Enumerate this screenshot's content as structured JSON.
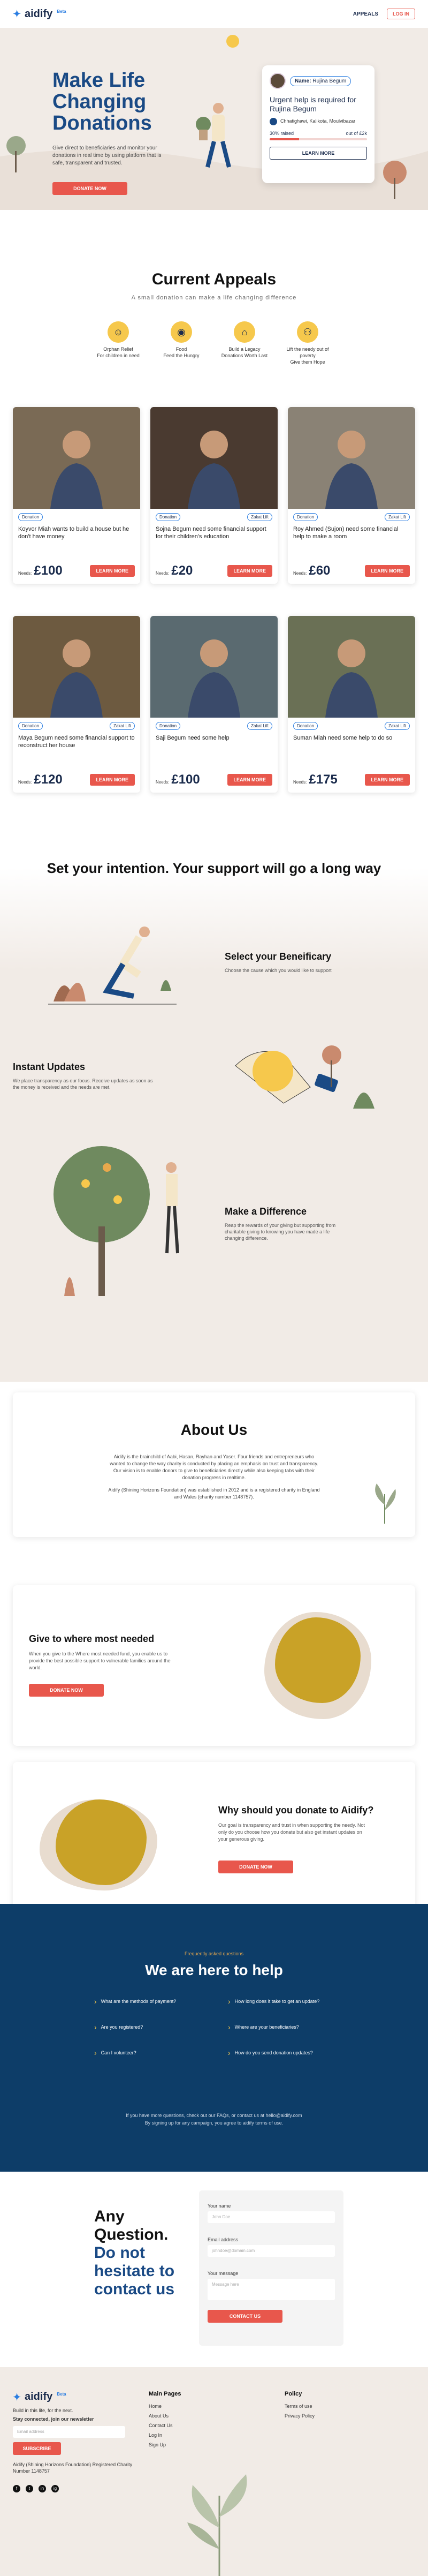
{
  "nav": {
    "logo": "aidify",
    "beta": "Beta",
    "appeals": "APPEALS",
    "login": "LOG IN"
  },
  "hero": {
    "title": "Make Life Changing Donations",
    "body": "Give direct to beneficiaries and monitor your donations in real time by using platform that is safe, transparent and trusted.",
    "cta": "DONATE NOW",
    "card": {
      "name_label": "Name:",
      "name": "Rujina Begum",
      "title": "Urgent help is required for Rujina Begum",
      "location": "Chhatighawi, Kalikota, Moulvibazar",
      "raised": "30% raised",
      "out_of": "out of £2k",
      "progress": 0.3,
      "cta": "LEARN MORE"
    }
  },
  "appeals": {
    "title": "Current Appeals",
    "subtitle": "A small donation can make a life changing difference",
    "categories": [
      {
        "icon": "orphan-relief-icon",
        "title": "Orphan Relief",
        "sub": "For children in need"
      },
      {
        "icon": "food-icon",
        "title": "Food",
        "sub": "Feed the Hungry"
      },
      {
        "icon": "legacy-icon",
        "title": "Build a Legacy",
        "sub": "Donations Worth Last"
      },
      {
        "icon": "lift-icon",
        "title": "Lift the needy out of poverty",
        "sub": "Give them Hope"
      }
    ],
    "cards": [
      {
        "tag1": "Donation",
        "tag2": "",
        "text": "Koyvor Miah wants to build a house but he don't have money",
        "needs": "Needs:",
        "amount": "£100",
        "cta": "LEARN MORE",
        "bg": "#7a6a55"
      },
      {
        "tag1": "Donation",
        "tag2": "Zakat Lift",
        "text": "Sojna Begum need some financial support for their children's education",
        "needs": "Needs:",
        "amount": "£20",
        "cta": "LEARN MORE",
        "bg": "#4a3a30"
      },
      {
        "tag1": "Donation",
        "tag2": "Zakat Lift",
        "text": "Roy Ahmed (Sujon) need some financial help to make a room",
        "needs": "Needs:",
        "amount": "£60",
        "cta": "LEARN MORE",
        "bg": "#8a8275"
      },
      {
        "tag1": "Donation",
        "tag2": "Zakat Lift",
        "text": "Maya Begum need some financial support to reconstruct her house",
        "needs": "Needs:",
        "amount": "£120",
        "cta": "LEARN MORE",
        "bg": "#6d5a40"
      },
      {
        "tag1": "Donation",
        "tag2": "Zakat Lift",
        "text": "Saji Begum need some help",
        "needs": "Needs:",
        "amount": "£100",
        "cta": "LEARN MORE",
        "bg": "#5a6a70"
      },
      {
        "tag1": "Donation",
        "tag2": "Zakat Lift",
        "text": "Suman Miah need some help to do so",
        "needs": "Needs:",
        "amount": "£175",
        "cta": "LEARN MORE",
        "bg": "#6a7055"
      }
    ]
  },
  "how": {
    "title": "Set your intention. Your support will go a long way",
    "steps": [
      {
        "title": "Select your Beneificary",
        "text": "Choose the cause which you would like to support"
      },
      {
        "title": "Instant Updates",
        "text": "We place transparency as our focus. Receive updates as soon as the money is received and the needs are met."
      },
      {
        "title": "Make a Difference",
        "text": "Reap the rewards of your giving but supporting from charitable giving to knowing you have made a life changing difference."
      }
    ]
  },
  "about": {
    "title": "About Us",
    "p1": "Aidify is the brainchild of Aabi, Hasan, Rayhan and Yaser. Four friends and entrepreneurs who wanted to change the way charity is conducted by placing an emphasis on trust and transparency. Our vision is to enable donors to give to beneficiaries directly while also keeping tabs with their donation progress in realtime.",
    "p2": "Aidify (Shining Horizons Foundation) was established in 2012 and is a registered charity in England and Wales (charity number 1148757)."
  },
  "need": {
    "title": "Give to where most needed",
    "text": "When you give to the Where most needed fund, you enable us to provide the best possible support to vulnerable families around the world.",
    "cta": "DONATE NOW"
  },
  "why": {
    "title": "Why should you donate to Aidify?",
    "text": "Our goal is transparency and trust in when supporting the needy. Not only do you choose how you donate but also get instant updates on your generous giving.",
    "cta": "DONATE NOW"
  },
  "faq": {
    "pre": "Frequently asked questions",
    "title": "We are here to help",
    "questions": [
      "What are the methods of payment?",
      "How long does it take to get an update?",
      "Are you registered?",
      "Where are your beneficiaries?",
      "Can I volunteer?",
      "How do you send donation updates?"
    ],
    "foot1": "If you have more questions, check out our FAQs, or contact us at hello@aidify.com",
    "foot2": "By signing up for any campaign, you agree to aidify terms of use."
  },
  "contact": {
    "l1": "Any",
    "l2": "Question.",
    "l3": "Do not",
    "l4": "hesitate to",
    "l5": "contact us",
    "name_label": "Your name",
    "name_ph": "John Doe",
    "email_label": "Email address",
    "email_ph": "johndoe@domain.com",
    "msg_label": "Your message",
    "msg_ph": "Message here",
    "cta": "CONTACT US"
  },
  "footer": {
    "tagline": "Build in this life, for the next.",
    "newsletter": "Stay connected, join our newsletter",
    "email_ph": "Email address",
    "subscribe": "SUBSCRIBE",
    "legal": "Aidify (Shining Horizons Foundation) Registered Charity Number 1148757",
    "main_h": "Main Pages",
    "main": [
      "Home",
      "About Us",
      "Contact Us",
      "Log In",
      "Sign Up"
    ],
    "policy_h": "Policy",
    "policy": [
      "Terms of use",
      "Privacy Policy"
    ],
    "social": [
      "f",
      "t",
      "in",
      "ig"
    ]
  }
}
